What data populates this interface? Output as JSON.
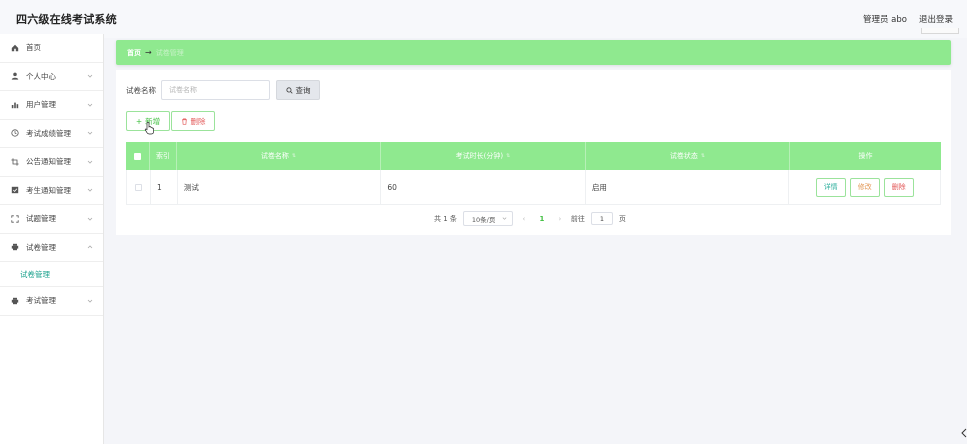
{
  "app_title": "四六级在线考试系统",
  "header": {
    "user": "管理员 abo",
    "logout": "退出登录"
  },
  "sidebar": {
    "items": [
      {
        "label": "首页",
        "icon": "home-icon",
        "has_children": false
      },
      {
        "label": "个人中心",
        "icon": "user-icon",
        "has_children": true
      },
      {
        "label": "用户管理",
        "icon": "chart-icon",
        "has_children": true
      },
      {
        "label": "考试成绩管理",
        "icon": "clock-icon",
        "has_children": true
      },
      {
        "label": "公告通知管理",
        "icon": "crop-icon",
        "has_children": true
      },
      {
        "label": "考生通知管理",
        "icon": "check-square-icon",
        "has_children": true
      },
      {
        "label": "试题管理",
        "icon": "expand-icon",
        "has_children": true
      },
      {
        "label": "试卷管理",
        "icon": "printer-icon",
        "has_children": true,
        "expanded": true,
        "children": [
          "试卷管理"
        ]
      },
      {
        "label": "考试管理",
        "icon": "printer-icon",
        "has_children": true
      }
    ]
  },
  "breadcrumb": {
    "home": "首页",
    "arrow": "→",
    "current": "试卷管理"
  },
  "search": {
    "label": "试卷名称",
    "placeholder": "试卷名称",
    "button": "查询"
  },
  "actions": {
    "add": "新增",
    "delete": "删除"
  },
  "table": {
    "columns": [
      "索引",
      "试卷名称",
      "考试时长(分钟)",
      "试卷状态",
      "操作"
    ],
    "rows": [
      {
        "index": "1",
        "name": "测试",
        "duration": "60",
        "status": "启用"
      }
    ],
    "row_actions": {
      "detail": "详情",
      "edit": "修改",
      "delete": "删除"
    }
  },
  "pagination": {
    "total": "共 1 条",
    "page_size": "10条/页",
    "current_page": "1",
    "goto_label": "前往",
    "goto_value": "1",
    "page_suffix": "页"
  },
  "colors": {
    "accent_green": "#8fe98f",
    "teal": "#1aa18c",
    "danger": "#e35a5a"
  }
}
